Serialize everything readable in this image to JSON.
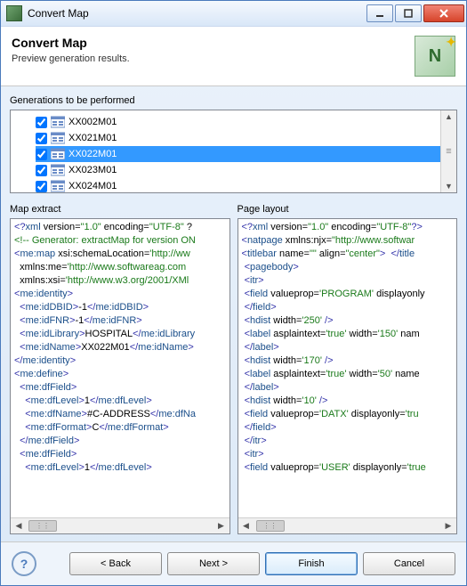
{
  "window": {
    "title": "Convert Map"
  },
  "header": {
    "title": "Convert Map",
    "subtitle": "Preview generation results.",
    "logo_letter": "N"
  },
  "generations": {
    "label": "Generations to be performed",
    "items": [
      {
        "name": "XX002M01",
        "checked": true,
        "selected": false
      },
      {
        "name": "XX021M01",
        "checked": true,
        "selected": false
      },
      {
        "name": "XX022M01",
        "checked": true,
        "selected": true
      },
      {
        "name": "XX023M01",
        "checked": true,
        "selected": false
      },
      {
        "name": "XX024M01",
        "checked": true,
        "selected": false
      }
    ]
  },
  "map_extract": {
    "label": "Map extract",
    "lines": [
      [
        {
          "c": "p",
          "t": "<?"
        },
        {
          "c": "t",
          "t": "xml"
        },
        {
          "c": "k",
          "t": " version="
        },
        {
          "c": "s",
          "t": "\"1.0\""
        },
        {
          "c": "k",
          "t": " encoding="
        },
        {
          "c": "s",
          "t": "\"UTF-8\""
        },
        {
          "c": "k",
          "t": " ?"
        }
      ],
      [
        {
          "c": "c",
          "t": "<!-- Generator: extractMap for version ON"
        }
      ],
      [
        {
          "c": "p",
          "t": "<"
        },
        {
          "c": "t",
          "t": "me:map"
        },
        {
          "c": "k",
          "t": " xsi:schemaLocation="
        },
        {
          "c": "s",
          "t": "'http://ww"
        }
      ],
      [
        {
          "c": "k",
          "t": "  xmlns:me="
        },
        {
          "c": "s",
          "t": "'http://www.softwareag.com"
        }
      ],
      [
        {
          "c": "k",
          "t": "  xmlns:xsi="
        },
        {
          "c": "s",
          "t": "'http://www.w3.org/2001/XMl"
        }
      ],
      [
        {
          "c": "p",
          "t": "<"
        },
        {
          "c": "t",
          "t": "me:identity"
        },
        {
          "c": "p",
          "t": ">"
        }
      ],
      [
        {
          "c": "k",
          "t": "  "
        },
        {
          "c": "p",
          "t": "<"
        },
        {
          "c": "t",
          "t": "me:idDBID"
        },
        {
          "c": "p",
          "t": ">"
        },
        {
          "c": "k",
          "t": "-1"
        },
        {
          "c": "p",
          "t": "</"
        },
        {
          "c": "t",
          "t": "me:idDBID"
        },
        {
          "c": "p",
          "t": ">"
        }
      ],
      [
        {
          "c": "k",
          "t": "  "
        },
        {
          "c": "p",
          "t": "<"
        },
        {
          "c": "t",
          "t": "me:idFNR"
        },
        {
          "c": "p",
          "t": ">"
        },
        {
          "c": "k",
          "t": "-1"
        },
        {
          "c": "p",
          "t": "</"
        },
        {
          "c": "t",
          "t": "me:idFNR"
        },
        {
          "c": "p",
          "t": ">"
        }
      ],
      [
        {
          "c": "k",
          "t": "  "
        },
        {
          "c": "p",
          "t": "<"
        },
        {
          "c": "t",
          "t": "me:idLibrary"
        },
        {
          "c": "p",
          "t": ">"
        },
        {
          "c": "k",
          "t": "HOSPITAL"
        },
        {
          "c": "p",
          "t": "</"
        },
        {
          "c": "t",
          "t": "me:idLibrary"
        }
      ],
      [
        {
          "c": "k",
          "t": "  "
        },
        {
          "c": "p",
          "t": "<"
        },
        {
          "c": "t",
          "t": "me:idName"
        },
        {
          "c": "p",
          "t": ">"
        },
        {
          "c": "k",
          "t": "XX022M01"
        },
        {
          "c": "p",
          "t": "</"
        },
        {
          "c": "t",
          "t": "me:idName"
        },
        {
          "c": "p",
          "t": ">"
        }
      ],
      [
        {
          "c": "p",
          "t": "</"
        },
        {
          "c": "t",
          "t": "me:identity"
        },
        {
          "c": "p",
          "t": ">"
        }
      ],
      [
        {
          "c": "p",
          "t": "<"
        },
        {
          "c": "t",
          "t": "me:define"
        },
        {
          "c": "p",
          "t": ">"
        }
      ],
      [
        {
          "c": "k",
          "t": "  "
        },
        {
          "c": "p",
          "t": "<"
        },
        {
          "c": "t",
          "t": "me:dfField"
        },
        {
          "c": "p",
          "t": ">"
        }
      ],
      [
        {
          "c": "k",
          "t": "    "
        },
        {
          "c": "p",
          "t": "<"
        },
        {
          "c": "t",
          "t": "me:dfLevel"
        },
        {
          "c": "p",
          "t": ">"
        },
        {
          "c": "k",
          "t": "1"
        },
        {
          "c": "p",
          "t": "</"
        },
        {
          "c": "t",
          "t": "me:dfLevel"
        },
        {
          "c": "p",
          "t": ">"
        }
      ],
      [
        {
          "c": "k",
          "t": "    "
        },
        {
          "c": "p",
          "t": "<"
        },
        {
          "c": "t",
          "t": "me:dfName"
        },
        {
          "c": "p",
          "t": ">"
        },
        {
          "c": "k",
          "t": "#C-ADDRESS"
        },
        {
          "c": "p",
          "t": "</"
        },
        {
          "c": "t",
          "t": "me:dfNa"
        }
      ],
      [
        {
          "c": "k",
          "t": "    "
        },
        {
          "c": "p",
          "t": "<"
        },
        {
          "c": "t",
          "t": "me:dfFormat"
        },
        {
          "c": "p",
          "t": ">"
        },
        {
          "c": "k",
          "t": "C"
        },
        {
          "c": "p",
          "t": "</"
        },
        {
          "c": "t",
          "t": "me:dfFormat"
        },
        {
          "c": "p",
          "t": ">"
        }
      ],
      [
        {
          "c": "k",
          "t": "  "
        },
        {
          "c": "p",
          "t": "</"
        },
        {
          "c": "t",
          "t": "me:dfField"
        },
        {
          "c": "p",
          "t": ">"
        }
      ],
      [
        {
          "c": "k",
          "t": "  "
        },
        {
          "c": "p",
          "t": "<"
        },
        {
          "c": "t",
          "t": "me:dfField"
        },
        {
          "c": "p",
          "t": ">"
        }
      ],
      [
        {
          "c": "k",
          "t": "    "
        },
        {
          "c": "p",
          "t": "<"
        },
        {
          "c": "t",
          "t": "me:dfLevel"
        },
        {
          "c": "p",
          "t": ">"
        },
        {
          "c": "k",
          "t": "1"
        },
        {
          "c": "p",
          "t": "</"
        },
        {
          "c": "t",
          "t": "me:dfLevel"
        },
        {
          "c": "p",
          "t": ">"
        }
      ]
    ]
  },
  "page_layout": {
    "label": "Page layout",
    "lines": [
      [
        {
          "c": "p",
          "t": "<?"
        },
        {
          "c": "t",
          "t": "xml"
        },
        {
          "c": "k",
          "t": " version="
        },
        {
          "c": "s",
          "t": "\"1.0\""
        },
        {
          "c": "k",
          "t": " encoding="
        },
        {
          "c": "s",
          "t": "\"UTF-8\""
        },
        {
          "c": "p",
          "t": "?>"
        }
      ],
      [
        {
          "c": "p",
          "t": "<"
        },
        {
          "c": "t",
          "t": "natpage"
        },
        {
          "c": "k",
          "t": " xmlns:njx="
        },
        {
          "c": "s",
          "t": "\"http://www.softwar"
        }
      ],
      [
        {
          "c": "p",
          "t": "<"
        },
        {
          "c": "t",
          "t": "titlebar"
        },
        {
          "c": "k",
          "t": " name="
        },
        {
          "c": "s",
          "t": "\"\""
        },
        {
          "c": "k",
          "t": " align="
        },
        {
          "c": "s",
          "t": "\"center\""
        },
        {
          "c": "p",
          "t": ">  </"
        },
        {
          "c": "t",
          "t": "title"
        }
      ],
      [
        {
          "c": "k",
          "t": " "
        },
        {
          "c": "p",
          "t": "<"
        },
        {
          "c": "t",
          "t": "pagebody"
        },
        {
          "c": "p",
          "t": ">"
        }
      ],
      [
        {
          "c": "k",
          "t": " "
        },
        {
          "c": "p",
          "t": "<"
        },
        {
          "c": "t",
          "t": "itr"
        },
        {
          "c": "p",
          "t": ">"
        }
      ],
      [
        {
          "c": "k",
          "t": " "
        },
        {
          "c": "p",
          "t": "<"
        },
        {
          "c": "t",
          "t": "field"
        },
        {
          "c": "k",
          "t": " valueprop="
        },
        {
          "c": "s",
          "t": "'PROGRAM'"
        },
        {
          "c": "k",
          "t": " displayonly"
        }
      ],
      [
        {
          "c": "k",
          "t": " "
        },
        {
          "c": "p",
          "t": "</"
        },
        {
          "c": "t",
          "t": "field"
        },
        {
          "c": "p",
          "t": ">"
        }
      ],
      [
        {
          "c": "k",
          "t": " "
        },
        {
          "c": "p",
          "t": "<"
        },
        {
          "c": "t",
          "t": "hdist"
        },
        {
          "c": "k",
          "t": " width="
        },
        {
          "c": "s",
          "t": "'250'"
        },
        {
          "c": "p",
          "t": " />"
        }
      ],
      [
        {
          "c": "k",
          "t": " "
        },
        {
          "c": "p",
          "t": "<"
        },
        {
          "c": "t",
          "t": "label"
        },
        {
          "c": "k",
          "t": " asplaintext="
        },
        {
          "c": "s",
          "t": "'true'"
        },
        {
          "c": "k",
          "t": " width="
        },
        {
          "c": "s",
          "t": "'150'"
        },
        {
          "c": "k",
          "t": " nam"
        }
      ],
      [
        {
          "c": "k",
          "t": " "
        },
        {
          "c": "p",
          "t": "</"
        },
        {
          "c": "t",
          "t": "label"
        },
        {
          "c": "p",
          "t": ">"
        }
      ],
      [
        {
          "c": "k",
          "t": " "
        },
        {
          "c": "p",
          "t": "<"
        },
        {
          "c": "t",
          "t": "hdist"
        },
        {
          "c": "k",
          "t": " width="
        },
        {
          "c": "s",
          "t": "'170'"
        },
        {
          "c": "p",
          "t": " />"
        }
      ],
      [
        {
          "c": "k",
          "t": " "
        },
        {
          "c": "p",
          "t": "<"
        },
        {
          "c": "t",
          "t": "label"
        },
        {
          "c": "k",
          "t": " asplaintext="
        },
        {
          "c": "s",
          "t": "'true'"
        },
        {
          "c": "k",
          "t": " width="
        },
        {
          "c": "s",
          "t": "'50'"
        },
        {
          "c": "k",
          "t": " name"
        }
      ],
      [
        {
          "c": "k",
          "t": " "
        },
        {
          "c": "p",
          "t": "</"
        },
        {
          "c": "t",
          "t": "label"
        },
        {
          "c": "p",
          "t": ">"
        }
      ],
      [
        {
          "c": "k",
          "t": " "
        },
        {
          "c": "p",
          "t": "<"
        },
        {
          "c": "t",
          "t": "hdist"
        },
        {
          "c": "k",
          "t": " width="
        },
        {
          "c": "s",
          "t": "'10'"
        },
        {
          "c": "p",
          "t": " />"
        }
      ],
      [
        {
          "c": "k",
          "t": " "
        },
        {
          "c": "p",
          "t": "<"
        },
        {
          "c": "t",
          "t": "field"
        },
        {
          "c": "k",
          "t": " valueprop="
        },
        {
          "c": "s",
          "t": "'DATX'"
        },
        {
          "c": "k",
          "t": " displayonly="
        },
        {
          "c": "s",
          "t": "'tru"
        }
      ],
      [
        {
          "c": "k",
          "t": " "
        },
        {
          "c": "p",
          "t": "</"
        },
        {
          "c": "t",
          "t": "field"
        },
        {
          "c": "p",
          "t": ">"
        }
      ],
      [
        {
          "c": "k",
          "t": " "
        },
        {
          "c": "p",
          "t": "</"
        },
        {
          "c": "t",
          "t": "itr"
        },
        {
          "c": "p",
          "t": ">"
        }
      ],
      [
        {
          "c": "k",
          "t": " "
        },
        {
          "c": "p",
          "t": "<"
        },
        {
          "c": "t",
          "t": "itr"
        },
        {
          "c": "p",
          "t": ">"
        }
      ],
      [
        {
          "c": "k",
          "t": " "
        },
        {
          "c": "p",
          "t": "<"
        },
        {
          "c": "t",
          "t": "field"
        },
        {
          "c": "k",
          "t": " valueprop="
        },
        {
          "c": "s",
          "t": "'USER'"
        },
        {
          "c": "k",
          "t": " displayonly="
        },
        {
          "c": "s",
          "t": "'true"
        }
      ]
    ]
  },
  "buttons": {
    "back": "< Back",
    "next": "Next >",
    "finish": "Finish",
    "cancel": "Cancel"
  }
}
